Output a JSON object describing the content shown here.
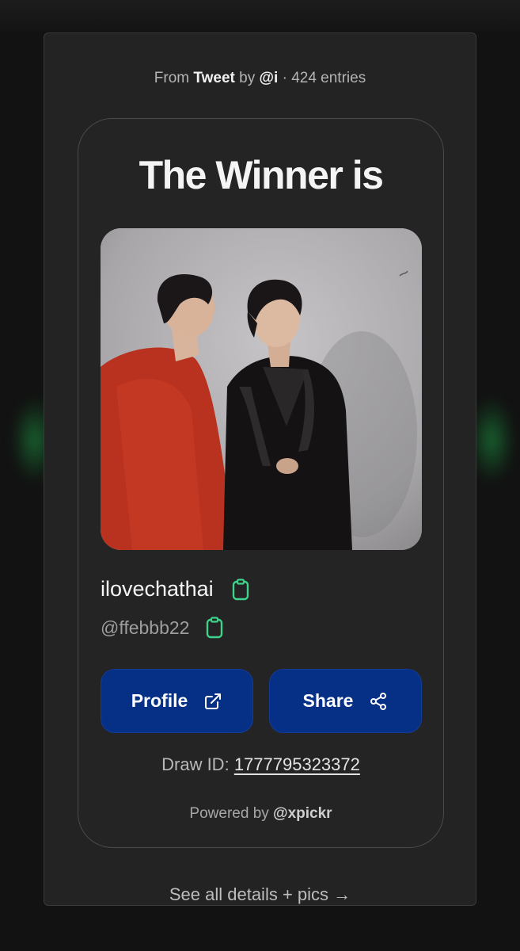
{
  "header": {
    "prefix": "From",
    "source": "Tweet",
    "by": "by",
    "author": "@i",
    "separator": "·",
    "entries": "424 entries"
  },
  "card": {
    "headline": "The Winner is",
    "display_name": "ilovechathai",
    "handle": "@ffebbb22",
    "profile_label": "Profile",
    "share_label": "Share",
    "draw_id_label": "Draw ID:",
    "draw_id_value": "1777795323372",
    "powered_prefix": "Powered by",
    "powered_brand": "@xpickr"
  },
  "footer": {
    "see_all": "See all details + pics →"
  },
  "icons": {
    "copy": "clipboard-icon",
    "external": "external-link-icon",
    "share": "share-icon"
  },
  "colors": {
    "accent_button": "#062f86",
    "copy_icon": "#3ed28a",
    "panel": "#232323"
  }
}
